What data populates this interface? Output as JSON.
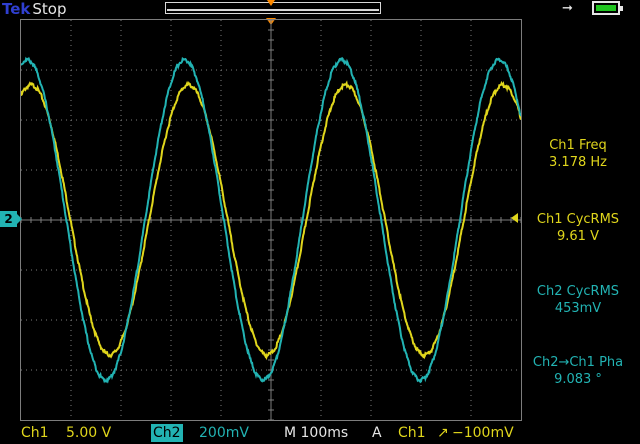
{
  "header": {
    "brand": "Tek",
    "status": "Stop"
  },
  "measurements": [
    {
      "label": "Ch1 Freq",
      "value": "3.178 Hz",
      "color": "#e0d61c"
    },
    {
      "label": "Ch1 CycRMS",
      "value": "9.61 V",
      "color": "#e0d61c"
    },
    {
      "label": "Ch2 CycRMS",
      "value": "453mV",
      "color": "#22b3b3"
    },
    {
      "label": "Ch2→Ch1 Pha",
      "value": "9.083 °",
      "color": "#22b3b3"
    }
  ],
  "channel2_marker": "2",
  "footer": {
    "ch1_label": "Ch1",
    "ch1_scale": "5.00 V",
    "ch2_label": "Ch2",
    "ch2_scale": "200mV",
    "timebase": "M 100ms",
    "trigger_mode": "A",
    "trigger_source": "Ch1",
    "trigger_edge": "↗",
    "trigger_level": "−100mV"
  },
  "icons": {
    "power": "ac-plug-icon",
    "battery": "battery-icon"
  },
  "colors": {
    "ch1": "#e0d61c",
    "ch2": "#22b3b3",
    "trigger": "#ff8a00",
    "grid": "#7d7d7d",
    "battery": "#1fc41f"
  },
  "chart_data": {
    "type": "line",
    "x_unit": "s",
    "x_range": [
      -0.5,
      0.5
    ],
    "y_divisions": 8,
    "x_divisions": 10,
    "grid": true,
    "series": [
      {
        "name": "Ch1",
        "frequency_hz": 3.178,
        "amplitude_div": 2.7,
        "offset_div": 0.0,
        "phase_deg": 0
      },
      {
        "name": "Ch2",
        "frequency_hz": 3.178,
        "amplitude_div": 3.2,
        "offset_div": 0.0,
        "phase_deg": 9.083
      }
    ]
  }
}
